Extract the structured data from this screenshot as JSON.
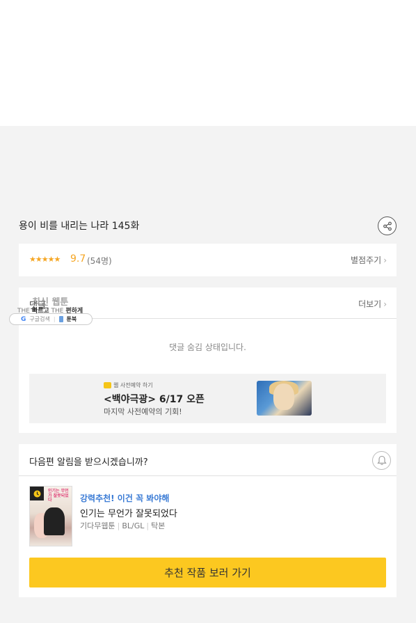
{
  "episode": {
    "title": "용이 비를 내리는 나라 145화",
    "share_icon": "share-icon"
  },
  "rating": {
    "stars": "★★★★★",
    "score": "9.7",
    "count": "(54명)",
    "rate_link": "별점주기",
    "chevron": "›"
  },
  "comments": {
    "label": "댓글",
    "overlay_latest": "최신 웹툰",
    "more_link": "더보기",
    "chevron": "›",
    "badge_pre": "THE",
    "badge_bold1": "빠르고",
    "badge_mid": "THE",
    "badge_bold2": "편하게",
    "badge_google": "구글검색",
    "badge_toonbook": "툰북",
    "hidden_message": "댓글 숨김 상태입니다."
  },
  "promo": {
    "small_label": "웹 사전예약 하기",
    "title": "<백야극광> 6/17 오픈",
    "subtitle": "마지막 사전예약의 기회!"
  },
  "alert": {
    "question": "다음편 알림을 받으시겠습니까?",
    "bell_icon": "bell-icon"
  },
  "recommendation": {
    "tag": "강력추천! 이건 꼭 봐야해",
    "title": "인기는 무언가 잘못되었다",
    "author": "기다무웹툰",
    "genre": "BL/GL",
    "status": "탁본",
    "cover_title": "인기는 무언가 잘못되었다",
    "button_label": "추천 작품 보러 가기"
  },
  "colors": {
    "star": "#f5a623",
    "accent_button": "#fcc820",
    "link_blue": "#3a7bd5",
    "page_bg": "#f3f3f3"
  }
}
